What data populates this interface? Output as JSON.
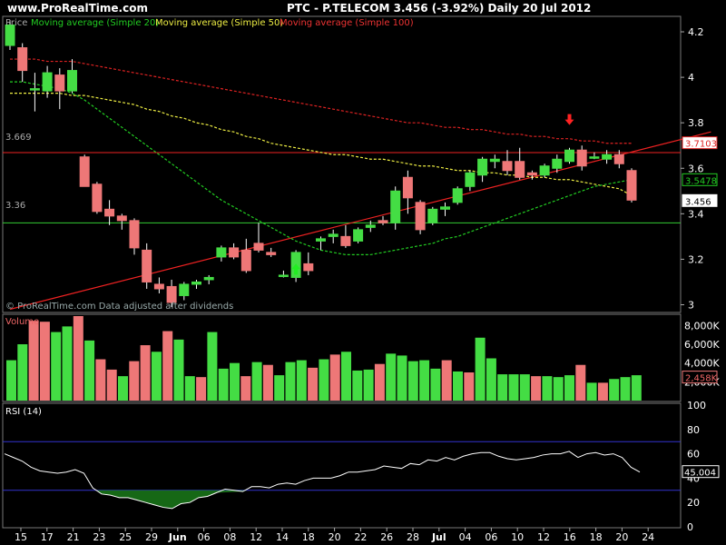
{
  "header": {
    "site": "www.ProRealTime.com",
    "title": "PTC - P.TELECOM    3.456 (-3.92%)    Daily  20 Jul 2012"
  },
  "colors": {
    "up": "#44dd44",
    "down": "#ee7777",
    "ma20": "#22cc22",
    "ma50": "#eeee44",
    "ma100": "#dd2222",
    "resistance": "#ee2222",
    "support": "#33cc33",
    "rsi_band": "#3333cc"
  },
  "chart_data": [
    {
      "type": "candlestick",
      "legend": [
        "Price",
        "Moving average (Simple 20)",
        "Moving average (Simple 50)",
        "Moving average (Simple 100)"
      ],
      "ylim": [
        2.97,
        4.26
      ],
      "y_ticks": [
        "4.2",
        "4",
        "3.8",
        "3.6",
        "3.4",
        "3.2",
        "3"
      ],
      "x_ticks": [
        "15",
        "17",
        "21",
        "23",
        "25",
        "29",
        "Jun",
        "06",
        "08",
        "12",
        "14",
        "18",
        "20",
        "22",
        "26",
        "28",
        "Jul",
        "04",
        "06",
        "10",
        "12",
        "16",
        "18",
        "20",
        "24"
      ],
      "horizontal_levels": [
        {
          "value": 3.669,
          "label": "3.669",
          "color": "#ee2222"
        },
        {
          "value": 3.36,
          "label": "3.36",
          "color": "#33cc33"
        }
      ],
      "trendline": {
        "from": [
          0,
          2.98
        ],
        "to": [
          52,
          3.7
        ]
      },
      "last_values": [
        "3.7103",
        "3.5478",
        "3.456"
      ],
      "watermark": "© ProRealTime.com  Data adjusted after dividends",
      "candles": [
        {
          "o": 4.14,
          "h": 4.25,
          "l": 4.12,
          "c": 4.23
        },
        {
          "o": 4.13,
          "h": 4.15,
          "l": 3.98,
          "c": 4.03
        },
        {
          "o": 3.95,
          "h": 4.02,
          "l": 3.85,
          "c": 3.95
        },
        {
          "o": 3.94,
          "h": 4.05,
          "l": 3.91,
          "c": 4.02
        },
        {
          "o": 4.01,
          "h": 4.04,
          "l": 3.86,
          "c": 3.94
        },
        {
          "o": 3.94,
          "h": 4.08,
          "l": 3.93,
          "c": 4.03
        },
        {
          "o": 3.65,
          "h": 3.66,
          "l": 3.52,
          "c": 3.52
        },
        {
          "o": 3.53,
          "h": 3.54,
          "l": 3.4,
          "c": 3.41
        },
        {
          "o": 3.42,
          "h": 3.46,
          "l": 3.35,
          "c": 3.39
        },
        {
          "o": 3.39,
          "h": 3.4,
          "l": 3.33,
          "c": 3.37
        },
        {
          "o": 3.37,
          "h": 3.38,
          "l": 3.22,
          "c": 3.25
        },
        {
          "o": 3.24,
          "h": 3.27,
          "l": 3.07,
          "c": 3.1
        },
        {
          "o": 3.09,
          "h": 3.12,
          "l": 3.05,
          "c": 3.07
        },
        {
          "o": 3.08,
          "h": 3.11,
          "l": 2.99,
          "c": 3.01
        },
        {
          "o": 3.04,
          "h": 3.1,
          "l": 3.02,
          "c": 3.09
        },
        {
          "o": 3.09,
          "h": 3.11,
          "l": 3.07,
          "c": 3.1
        },
        {
          "o": 3.11,
          "h": 3.13,
          "l": 3.09,
          "c": 3.12
        },
        {
          "o": 3.21,
          "h": 3.26,
          "l": 3.19,
          "c": 3.25
        },
        {
          "o": 3.25,
          "h": 3.27,
          "l": 3.2,
          "c": 3.21
        },
        {
          "o": 3.24,
          "h": 3.29,
          "l": 3.14,
          "c": 3.15
        },
        {
          "o": 3.27,
          "h": 3.36,
          "l": 3.23,
          "c": 3.24
        },
        {
          "o": 3.23,
          "h": 3.25,
          "l": 3.21,
          "c": 3.22
        },
        {
          "o": 3.13,
          "h": 3.15,
          "l": 3.12,
          "c": 3.13
        },
        {
          "o": 3.12,
          "h": 3.24,
          "l": 3.1,
          "c": 3.23
        },
        {
          "o": 3.18,
          "h": 3.23,
          "l": 3.13,
          "c": 3.15
        },
        {
          "o": 3.28,
          "h": 3.3,
          "l": 3.24,
          "c": 3.29
        },
        {
          "o": 3.3,
          "h": 3.33,
          "l": 3.27,
          "c": 3.31
        },
        {
          "o": 3.3,
          "h": 3.35,
          "l": 3.25,
          "c": 3.26
        },
        {
          "o": 3.28,
          "h": 3.34,
          "l": 3.27,
          "c": 3.33
        },
        {
          "o": 3.34,
          "h": 3.37,
          "l": 3.32,
          "c": 3.35
        },
        {
          "o": 3.37,
          "h": 3.39,
          "l": 3.35,
          "c": 3.36
        },
        {
          "o": 3.36,
          "h": 3.52,
          "l": 3.33,
          "c": 3.5
        },
        {
          "o": 3.56,
          "h": 3.59,
          "l": 3.4,
          "c": 3.47
        },
        {
          "o": 3.45,
          "h": 3.46,
          "l": 3.31,
          "c": 3.33
        },
        {
          "o": 3.36,
          "h": 3.43,
          "l": 3.35,
          "c": 3.42
        },
        {
          "o": 3.42,
          "h": 3.45,
          "l": 3.39,
          "c": 3.43
        },
        {
          "o": 3.45,
          "h": 3.52,
          "l": 3.44,
          "c": 3.51
        },
        {
          "o": 3.52,
          "h": 3.59,
          "l": 3.5,
          "c": 3.58
        },
        {
          "o": 3.57,
          "h": 3.65,
          "l": 3.54,
          "c": 3.64
        },
        {
          "o": 3.63,
          "h": 3.66,
          "l": 3.6,
          "c": 3.64
        },
        {
          "o": 3.63,
          "h": 3.68,
          "l": 3.57,
          "c": 3.59
        },
        {
          "o": 3.63,
          "h": 3.69,
          "l": 3.55,
          "c": 3.56
        },
        {
          "o": 3.58,
          "h": 3.59,
          "l": 3.55,
          "c": 3.57
        },
        {
          "o": 3.57,
          "h": 3.62,
          "l": 3.56,
          "c": 3.61
        },
        {
          "o": 3.6,
          "h": 3.66,
          "l": 3.58,
          "c": 3.64
        },
        {
          "o": 3.63,
          "h": 3.69,
          "l": 3.62,
          "c": 3.68
        },
        {
          "o": 3.68,
          "h": 3.7,
          "l": 3.59,
          "c": 3.61
        },
        {
          "o": 3.65,
          "h": 3.67,
          "l": 3.64,
          "c": 3.65
        },
        {
          "o": 3.64,
          "h": 3.68,
          "l": 3.62,
          "c": 3.66
        },
        {
          "o": 3.66,
          "h": 3.68,
          "l": 3.6,
          "c": 3.62
        },
        {
          "o": 3.59,
          "h": 3.6,
          "l": 3.45,
          "c": 3.46
        }
      ],
      "ma20": [
        3.98,
        3.98,
        3.97,
        3.96,
        3.95,
        3.93,
        3.9,
        3.86,
        3.82,
        3.78,
        3.74,
        3.7,
        3.66,
        3.62,
        3.58,
        3.54,
        3.5,
        3.46,
        3.43,
        3.4,
        3.37,
        3.34,
        3.31,
        3.28,
        3.26,
        3.24,
        3.23,
        3.22,
        3.22,
        3.22,
        3.23,
        3.24,
        3.25,
        3.26,
        3.27,
        3.29,
        3.3,
        3.32,
        3.34,
        3.36,
        3.38,
        3.4,
        3.42,
        3.44,
        3.46,
        3.48,
        3.5,
        3.52,
        3.53,
        3.54,
        3.55
      ],
      "ma50": [
        3.93,
        3.93,
        3.93,
        3.93,
        3.93,
        3.92,
        3.92,
        3.91,
        3.9,
        3.89,
        3.88,
        3.86,
        3.85,
        3.83,
        3.82,
        3.8,
        3.79,
        3.77,
        3.76,
        3.74,
        3.73,
        3.71,
        3.7,
        3.69,
        3.68,
        3.67,
        3.66,
        3.66,
        3.65,
        3.64,
        3.64,
        3.63,
        3.62,
        3.61,
        3.61,
        3.6,
        3.59,
        3.59,
        3.58,
        3.58,
        3.57,
        3.57,
        3.56,
        3.56,
        3.55,
        3.55,
        3.54,
        3.53,
        3.52,
        3.51,
        3.48
      ],
      "ma100": [
        4.08,
        4.08,
        4.08,
        4.07,
        4.07,
        4.07,
        4.06,
        4.05,
        4.04,
        4.03,
        4.02,
        4.01,
        4.0,
        3.99,
        3.98,
        3.97,
        3.96,
        3.95,
        3.94,
        3.93,
        3.92,
        3.91,
        3.9,
        3.89,
        3.88,
        3.87,
        3.86,
        3.85,
        3.84,
        3.83,
        3.82,
        3.81,
        3.8,
        3.8,
        3.79,
        3.78,
        3.78,
        3.77,
        3.77,
        3.76,
        3.75,
        3.75,
        3.74,
        3.74,
        3.73,
        3.73,
        3.72,
        3.72,
        3.71,
        3.71,
        3.71
      ],
      "signals": [
        {
          "index": 45,
          "price": 3.81,
          "direction": "down"
        },
        {
          "index": 23,
          "price": 3.16,
          "direction": "up"
        }
      ]
    },
    {
      "type": "bar",
      "title": "Volume",
      "y_ticks": [
        "8,000K",
        "6,000K",
        "4,000K",
        "2,000K"
      ],
      "ylim": [
        0,
        9000
      ],
      "last_value": "2,458K",
      "values": [
        4300,
        6000,
        8500,
        8400,
        7300,
        7900,
        9000,
        6400,
        4400,
        3300,
        2600,
        4200,
        5900,
        5200,
        7400,
        6500,
        2600,
        2500,
        7300,
        3400,
        4000,
        2600,
        4100,
        3800,
        2700,
        4100,
        4300,
        3500,
        4400,
        4900,
        5200,
        3200,
        3300,
        3900,
        5000,
        4800,
        4200,
        4300,
        3400,
        4300,
        3100,
        3000,
        6700,
        4500,
        2800,
        2800,
        2800,
        2600,
        2600,
        2500,
        2700,
        3800,
        1900,
        1900,
        2300,
        2500,
        2700
      ]
    },
    {
      "type": "line",
      "title": "RSI (14)",
      "ylim": [
        0,
        100
      ],
      "y_ticks": [
        "100",
        "80",
        "60",
        "40",
        "20",
        "0"
      ],
      "bands": [
        70,
        30
      ],
      "last_value": "45.004",
      "values": [
        60,
        57,
        54,
        49,
        46,
        45,
        44,
        45,
        47,
        44,
        32,
        27,
        26,
        24,
        24,
        22,
        20,
        18,
        16,
        15,
        19,
        20,
        24,
        25,
        28,
        31,
        30,
        29,
        33,
        33,
        32,
        35,
        36,
        35,
        38,
        40,
        40,
        40,
        42,
        45,
        45,
        46,
        47,
        50,
        49,
        48,
        52,
        51,
        55,
        54,
        57,
        55,
        58,
        60,
        61,
        61,
        58,
        56,
        55,
        56,
        57,
        59,
        60,
        60,
        62,
        57,
        60,
        61,
        59,
        60,
        57,
        49,
        45
      ]
    }
  ]
}
